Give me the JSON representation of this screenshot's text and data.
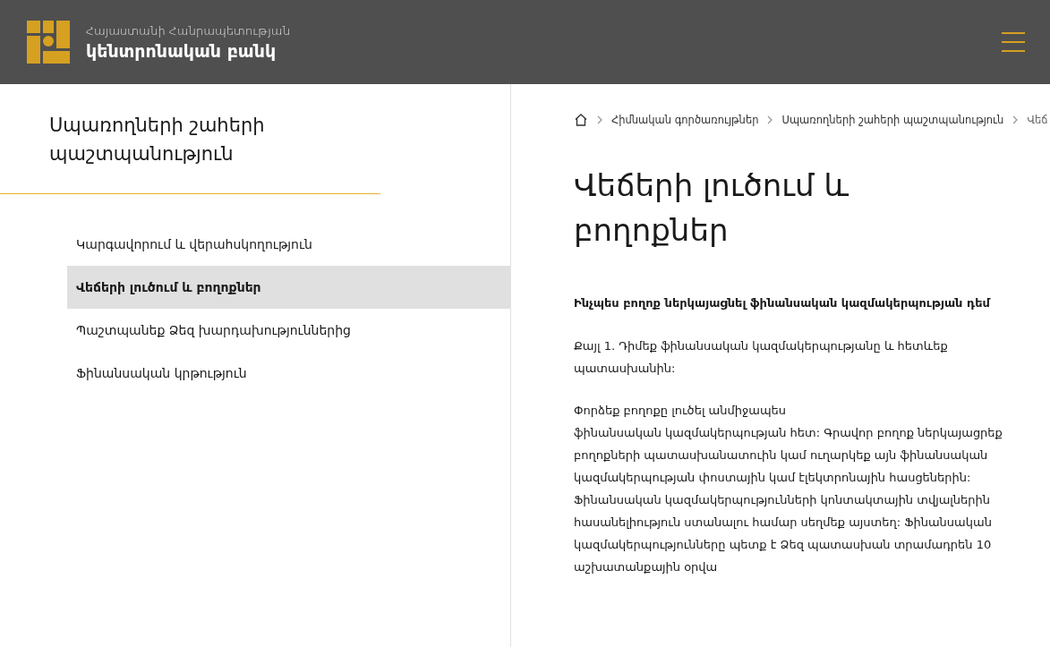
{
  "header": {
    "logo_line_1": "Հայաստանի Հանրապետության",
    "logo_line_2": "կենտրոնական բանկ"
  },
  "sidebar": {
    "title": "Սպառողների շահերի պաշտպանություն",
    "items": [
      {
        "label": "Կարգավորում և վերահսկողություն",
        "selected": false
      },
      {
        "label": "Վեճերի լուծում և բողոքներ",
        "selected": true
      },
      {
        "label": "Պաշտպանեք Ձեզ խարդախություններից",
        "selected": false
      },
      {
        "label": "Ֆինանսական կրթություն",
        "selected": false
      }
    ]
  },
  "breadcrumb": [
    "Հիմնական գործառույթներ",
    "Սպառողների շահերի պաշտպանություն",
    "Վեճ"
  ],
  "article": {
    "title": "Վեճերի լուծում և բողոքներ",
    "subtitle": "Ինչպես բողոք ներկայացնել ֆինանսական կազմակերպության դեմ",
    "paragraphs": [
      [
        "Քայլ 1. Դիմեք ֆինանսական կազմակերպությանը և հետևեք պատասխանին:"
      ],
      [
        "Փորձեք բողոքը լուծել անմիջապես",
        "ֆինանսական կազմակերպության հետ: Գրավոր բողոք ներկայացրեք բողոքների պատասխանատուին կամ ուղարկեք այն ֆինանսական կազմակերպության փոստային կամ էլեկտրոնային հասցեներին: Ֆինանսական կազմակերպությունների կոնտակտային տվյալներին հասանելիություն ստանալու համար սեղմեք այստեղ: Ֆինանսական կազմակերպությունները պետք է Ձեզ պատասխան տրամադրեն 10 աշխատանքային օրվա"
      ]
    ]
  }
}
